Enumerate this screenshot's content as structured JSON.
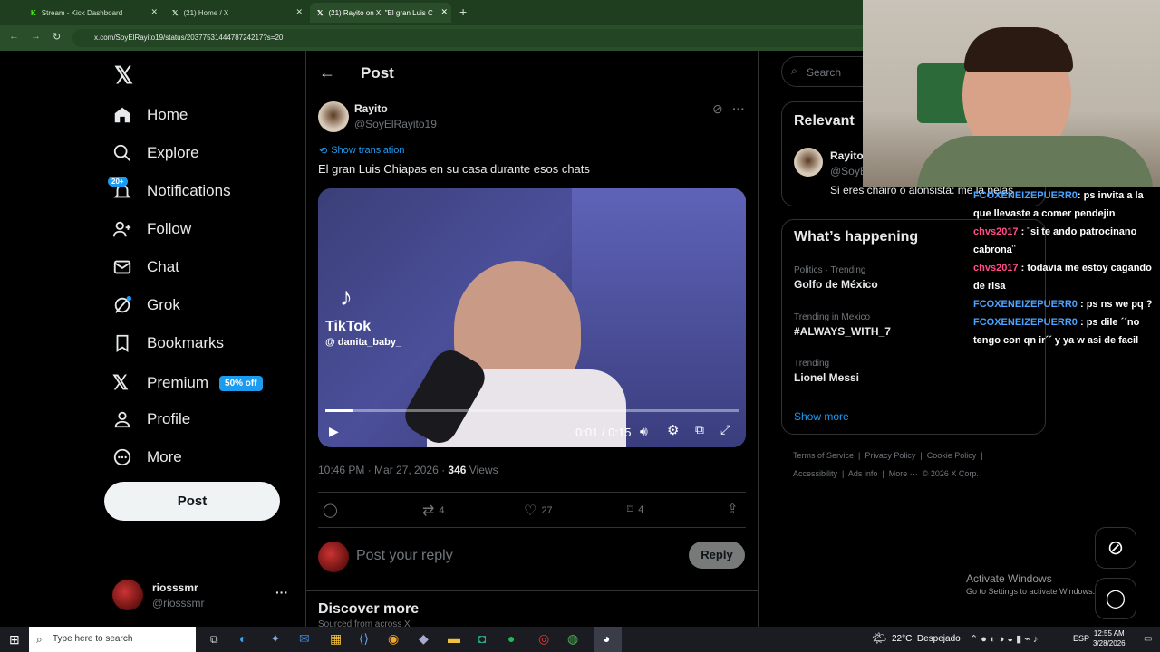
{
  "browser": {
    "tabs": [
      "Stream - Kick Dashboard",
      "(21) Home / X",
      "(21) Rayito on X: \"El gran Luis C"
    ],
    "url": "x.com/SoyElRayito19/status/2037753144478724217?s=20"
  },
  "sidebar": {
    "items": [
      "Home",
      "Explore",
      "Notifications",
      "Follow",
      "Chat",
      "Grok",
      "Bookmarks",
      "Premium",
      "Profile",
      "More"
    ],
    "notif_badge": "20+",
    "premium_badge": "50% off",
    "post_button": "Post",
    "account_name": "riosssmr",
    "account_handle": "@riosssmr"
  },
  "post": {
    "header": "Post",
    "author_name": "Rayito",
    "author_handle": "@SoyElRayito19",
    "translate": "Show translation",
    "text": "El gran Luis Chiapas en su casa durante esos chats",
    "video_time": "0:01 / 0:15",
    "watermark_brand": "TikTok",
    "watermark_user": "@ danita_baby_",
    "timestamp": "10:46 PM · Mar 27, 2026 · ",
    "views_count": "346",
    "views_label": " Views",
    "retweets": "4",
    "likes": "27",
    "bookmarks": "4",
    "reply_placeholder": "Post your reply",
    "reply_button": "Reply",
    "discover_title": "Discover more",
    "discover_sub": "Sourced from across X"
  },
  "right": {
    "search_placeholder": "Search",
    "relevant_title": "Relevant",
    "relevant_name": "Rayito",
    "relevant_handle": "@SoyE",
    "relevant_bio": "Si eres chairo o alonsista: me la pelas",
    "happening_title": "What’s happening",
    "trends": [
      {
        "context": "Politics · Trending",
        "name": "Golfo de México"
      },
      {
        "context": "Trending in Mexico",
        "name": "#ALWAYS_WITH_7"
      },
      {
        "context": "Trending",
        "name": "Lionel Messi"
      }
    ],
    "show_more": "Show more",
    "footer1": "Terms of Service  |  Privacy Policy  |  Cookie Policy  |",
    "footer2": "Accessibility  |  Ads info  |  More ···  © 2026 X Corp."
  },
  "chat": {
    "lines": [
      {
        "user": "FCOXENEIZEPUERR0",
        "text": ": ps invita a la que llevaste a comer pendejin"
      },
      {
        "user": "chvs2017",
        "text": ": ¨si te ando patrocinano cabrona¨"
      },
      {
        "user": "chvs2017",
        "text": ": todavia me estoy cagando de risa"
      },
      {
        "user": "FCOXENEIZEPUERR0",
        "text": ": ps ns we pq ?"
      },
      {
        "user": "FCOXENEIZEPUERR0",
        "text": ": ps dile ´´no tengo con qn ir´´ y ya w asi de facil"
      }
    ]
  },
  "windows": {
    "activate_title": "Activate Windows",
    "activate_sub": "Go to Settings to activate Windows."
  },
  "taskbar": {
    "search": "Type here to search",
    "weather": "22°C  Despejado",
    "lang": "ESP",
    "time": "12:55 AM",
    "date": "3/28/2026"
  },
  "colors": {
    "accent": "#1d9bf0",
    "browser": "#2a4d2a"
  }
}
